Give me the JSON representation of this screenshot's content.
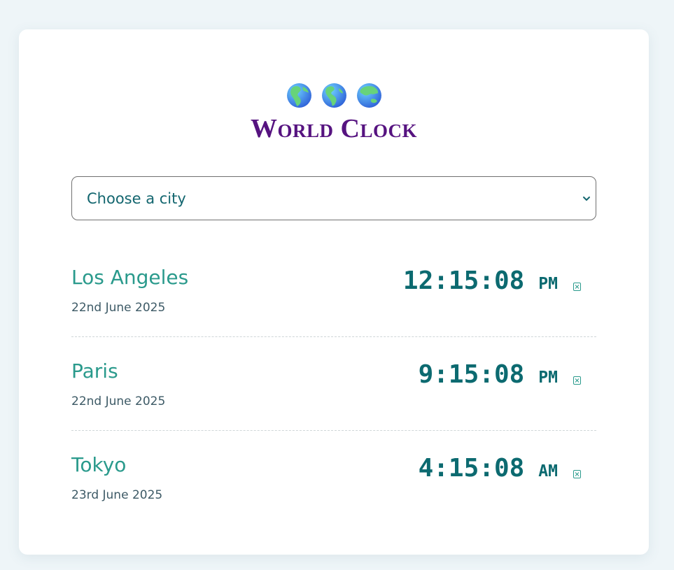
{
  "app": {
    "title": "World Clock",
    "header_icons": [
      "globe-europe-africa-icon",
      "globe-americas-icon",
      "globe-asia-australia-icon"
    ]
  },
  "city_select": {
    "selected_label": "Choose a city"
  },
  "clocks": [
    {
      "city": "Los Angeles",
      "date": "22nd June 2025",
      "time": "12:15:08",
      "ampm": "PM",
      "remove_icon": "close-box-icon"
    },
    {
      "city": "Paris",
      "date": "22nd June 2025",
      "time": "9:15:08",
      "ampm": "PM",
      "remove_icon": "close-box-icon"
    },
    {
      "city": "Tokyo",
      "date": "23rd June 2025",
      "time": "4:15:08",
      "ampm": "AM",
      "remove_icon": "close-box-icon"
    }
  ],
  "colors": {
    "page_background": "#eef5f8",
    "card_background": "#ffffff",
    "title": "#561380",
    "city_name": "#2a9a8c",
    "time": "#0c6a70",
    "date": "#3d5a66",
    "select_text": "#13666f"
  }
}
